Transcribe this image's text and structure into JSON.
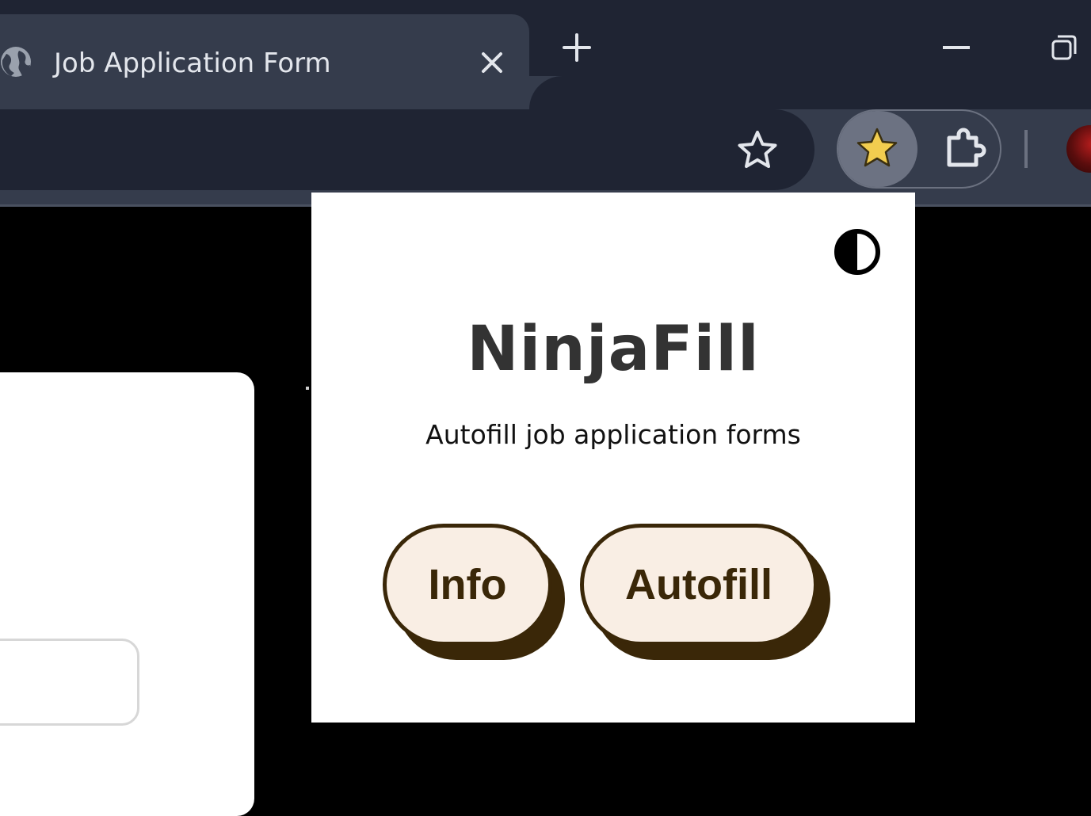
{
  "browser": {
    "tab": {
      "title": "Job Application Form",
      "favicon": "globe-icon"
    },
    "controls": [
      "close-icon",
      "plus-icon",
      "minimize-icon",
      "restore-icon"
    ],
    "toolbar": {
      "icons": [
        "bookmark-star-icon",
        "ninjafill-star-icon",
        "puzzle-icon",
        "avatar"
      ]
    },
    "colors": {
      "titlebar": "#1f2433",
      "tab": "#353c4c",
      "accent_star": "#f2cd4f"
    }
  },
  "popup": {
    "title": "NinjaFill",
    "subtitle": "Autofill job application forms",
    "buttons": {
      "info": "Info",
      "autofill": "Autofill"
    },
    "theme_toggle_icon": "contrast-icon",
    "colors": {
      "button_fill": "#f9eee4",
      "button_ink": "#3a2708",
      "title": "#333333"
    }
  }
}
